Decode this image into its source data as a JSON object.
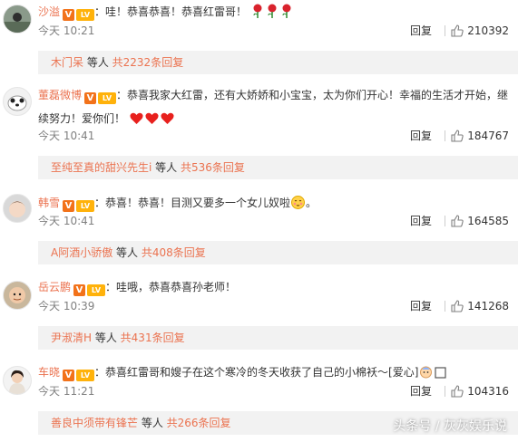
{
  "colors": {
    "username": "#eb7350",
    "accent_orange": "#f2721a",
    "meta_grey": "#808080",
    "subbox_bg": "#f2f2f2"
  },
  "comments": [
    {
      "username": "沙溢",
      "badge_v": "V",
      "badge_level": "LV",
      "separator": "：",
      "text": "哇！恭喜恭喜！恭喜红雷哥！",
      "emojis": [
        "rose-emoji",
        "rose-emoji",
        "rose-emoji"
      ],
      "time": "今天 10:21",
      "reply_label": "回复",
      "likes": "210392",
      "sub_name": "木门呆",
      "sub_mid": " 等人 ",
      "sub_total": "共2232条回复"
    },
    {
      "username": "董磊微博",
      "badge_v": "V",
      "badge_level": "LV",
      "separator": "：",
      "text": "恭喜我家大红雷，还有大娇娇和小宝宝，太为你们开心！幸福的生活才开始，继续努力！爱你们！",
      "emojis": [
        "heart-emoji",
        "heart-emoji",
        "heart-emoji"
      ],
      "time": "今天 10:41",
      "reply_label": "回复",
      "likes": "184767",
      "sub_name": "至纯至真的甜兴先生i",
      "sub_mid": " 等人 ",
      "sub_total": "共536条回复"
    },
    {
      "username": "韩雪",
      "badge_v": "V",
      "badge_level": "LV",
      "separator": "：",
      "text": "恭喜！恭喜！目测又要多一个女儿奴啦",
      "emojis": [
        "shy-face-emoji"
      ],
      "text_after": "。",
      "time": "今天 10:41",
      "reply_label": "回复",
      "likes": "164585",
      "sub_name": "A阿酒小骄傲",
      "sub_mid": " 等人 ",
      "sub_total": "共408条回复"
    },
    {
      "username": "岳云鹏",
      "badge_v": "V",
      "badge_level": "LV",
      "separator": "：",
      "text": "哇哦，恭喜恭喜孙老师！",
      "emojis": [],
      "time": "今天 10:39",
      "reply_label": "回复",
      "likes": "141268",
      "sub_name": "尹淑清H",
      "sub_mid": " 等人 ",
      "sub_total": "共431条回复"
    },
    {
      "username": "车晓",
      "badge_v": "V",
      "badge_level": "LV",
      "separator": "：",
      "text": "恭喜红雷哥和嫂子在这个寒冷的冬天收获了自己的小棉袄～[爱心]",
      "emojis": [
        "baby-emoji",
        "box-emoji"
      ],
      "time": "今天 11:21",
      "reply_label": "回复",
      "likes": "104316",
      "sub_name": "善良中须带有锋芒",
      "sub_mid": " 等人 ",
      "sub_total": "共266条回复"
    }
  ],
  "watermark": "头条号 / 灰灰娱乐说"
}
